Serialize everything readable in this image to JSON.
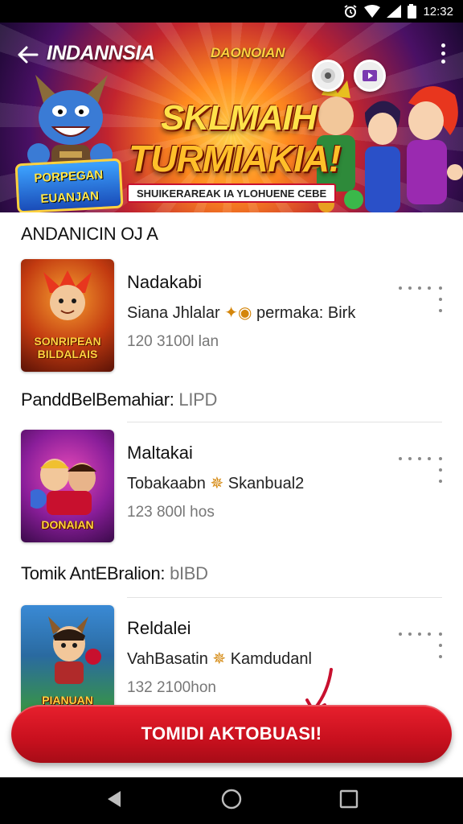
{
  "status_bar": {
    "time": "12:32"
  },
  "banner": {
    "brand": "INDANNSIA",
    "brand_secondary": "DAONOIAN",
    "title_line1": "SKLMAIH",
    "title_line2": "TURMIAKIA!",
    "tagline": "SHUIKERAREAK IA YLOHUENE CEBE",
    "logo_text_1": "PORPEGAN",
    "logo_text_2": "EUANJAN",
    "carousel": {
      "count": 3,
      "active_index": 1
    }
  },
  "sections": [
    {
      "title": "ANDANICIN OJ A",
      "title_suffix": "",
      "game": {
        "name": "Nadakabi",
        "desc_pre": "Sianа Jhlalar",
        "desc_accent": "permaka: Birk",
        "meta": "120 3100l lan",
        "thumb_label": "SONRIPEAN BILDALAIS",
        "thumb_palette": [
          "#8a1a0a",
          "#e06a12"
        ]
      }
    },
    {
      "title": "PanddBelBemahiar:",
      "title_suffix": "LIPD",
      "game": {
        "name": "Maltakai",
        "desc_pre": "Tobakaabn",
        "desc_accent": "Skanbual2",
        "meta": "123 800l hos",
        "thumb_label": "DONAIAN",
        "thumb_palette": [
          "#5a0f7a",
          "#d63ba0"
        ]
      }
    },
    {
      "title": "Tomik AntEBralion:",
      "title_suffix": "bIBD",
      "game": {
        "name": "Reldalei",
        "desc_pre": "VahBasatin",
        "desc_accent": "Kamdudanl",
        "meta": "132 2100hon",
        "thumb_label": "PIANUAN",
        "thumb_palette": [
          "#1f6fbf",
          "#43b04a"
        ]
      }
    }
  ],
  "cta": {
    "label": "TOMIDI AKTOBUASI!",
    "color": "#d4131f"
  }
}
